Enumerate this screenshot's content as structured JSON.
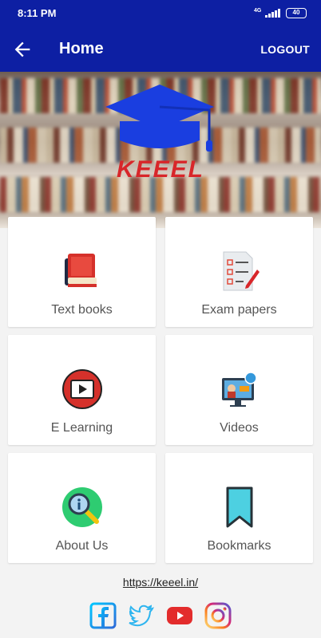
{
  "status": {
    "time": "8:11 PM",
    "network": "4G",
    "battery": "40"
  },
  "appbar": {
    "title": "Home",
    "logout_label": "LOGOUT"
  },
  "banner": {
    "brand": "KEEEL"
  },
  "menu": [
    {
      "label": "Text books",
      "icon": "books-icon"
    },
    {
      "label": "Exam papers",
      "icon": "exam-papers-icon"
    },
    {
      "label": "E Learning",
      "icon": "play-icon"
    },
    {
      "label": "Videos",
      "icon": "video-lesson-icon"
    },
    {
      "label": "About Us",
      "icon": "info-magnifier-icon"
    },
    {
      "label": "Bookmarks",
      "icon": "bookmark-icon"
    }
  ],
  "footer": {
    "link": "https://keeel.in/"
  },
  "colors": {
    "primary": "#0d1fa3",
    "brand_red": "#d8262a",
    "cap_blue": "#1a3ee0"
  }
}
